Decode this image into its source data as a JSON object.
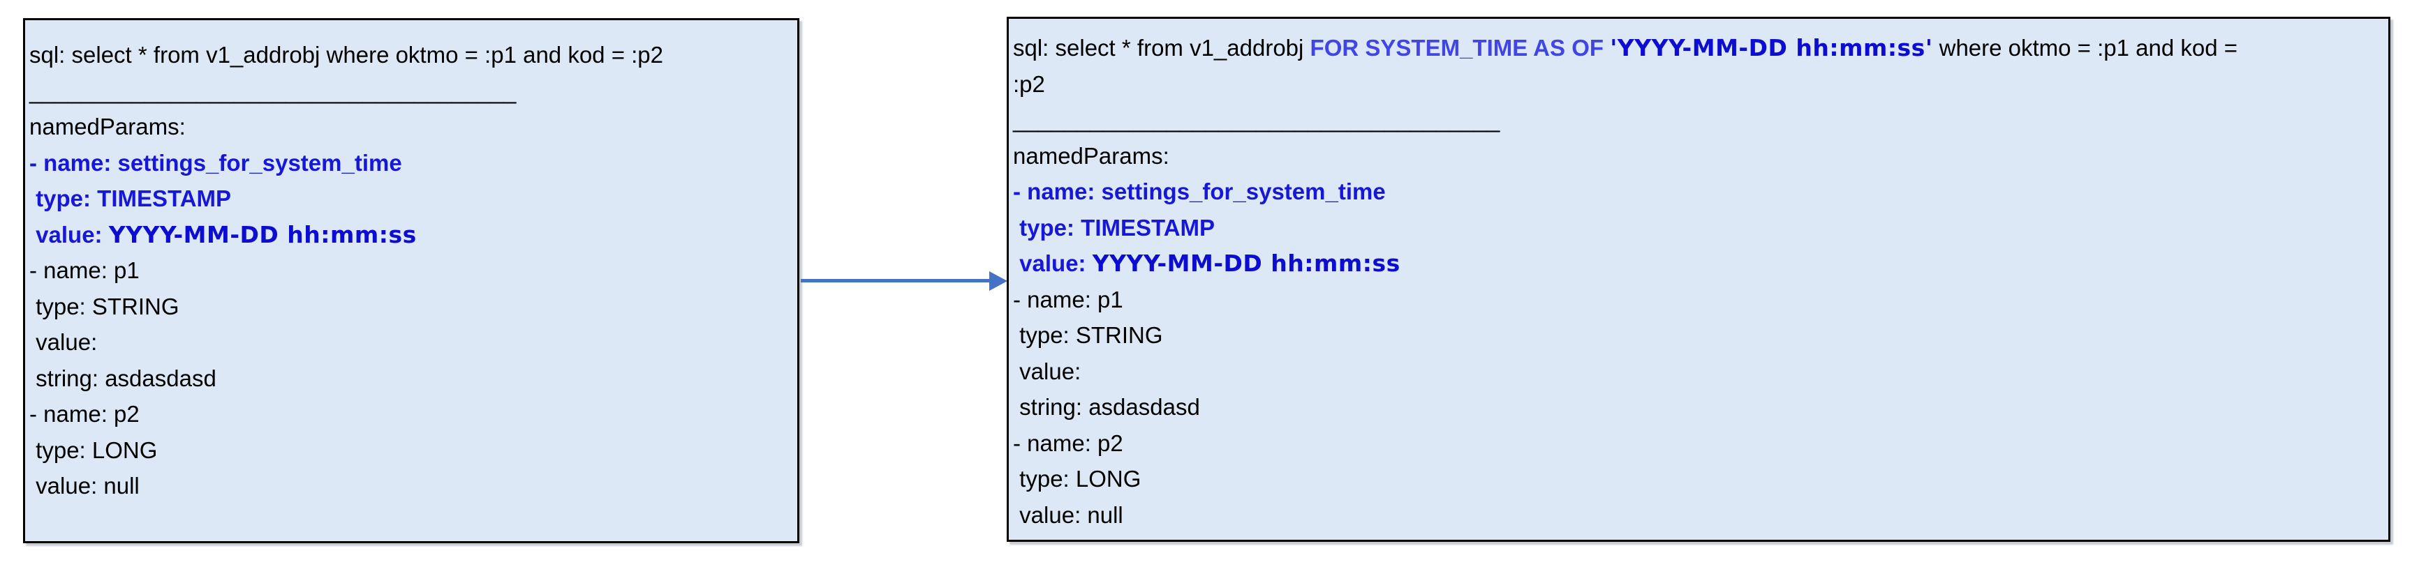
{
  "colors": {
    "box_fill": "#dce8f5",
    "box_border": "#000000",
    "text": "#000000",
    "keyword_blue": "#4045e4",
    "param_blue": "#1717d8",
    "timestamp_blue": "#0d0dd2",
    "arrow_blue": "#4472c4"
  },
  "left_box": {
    "lines": [
      {
        "name": "sql-line",
        "segments": [
          {
            "t": "sql: select * from v1_addrobj where oktmo = :p1 and kod = :p2",
            "s": "plain"
          }
        ]
      },
      {
        "name": "separator-line",
        "segments": [
          {
            "t": "______________________________________",
            "s": "plain"
          }
        ]
      },
      {
        "name": "named-params-label",
        "segments": [
          {
            "t": "namedParams:",
            "s": "plain"
          }
        ]
      },
      {
        "name": "param-settings-name",
        "segments": [
          {
            "t": "- name: settings_for_system_time",
            "s": "param"
          }
        ]
      },
      {
        "name": "param-settings-type",
        "segments": [
          {
            "t": " type: TIMESTAMP",
            "s": "param"
          }
        ]
      },
      {
        "name": "param-settings-value",
        "segments": [
          {
            "t": " value: ",
            "s": "param"
          },
          {
            "t": "YYYY-MM-DD hh:mm:ss",
            "s": "emph"
          }
        ]
      },
      {
        "name": "param-p1-name",
        "segments": [
          {
            "t": "- name: p1",
            "s": "plain"
          }
        ]
      },
      {
        "name": "param-p1-type",
        "segments": [
          {
            "t": " type: STRING",
            "s": "plain"
          }
        ]
      },
      {
        "name": "param-p1-value",
        "segments": [
          {
            "t": " value:",
            "s": "plain"
          }
        ]
      },
      {
        "name": "param-p1-string",
        "segments": [
          {
            "t": " string: asdasdasd",
            "s": "plain"
          }
        ]
      },
      {
        "name": "param-p2-name",
        "segments": [
          {
            "t": "- name: p2",
            "s": "plain"
          }
        ]
      },
      {
        "name": "param-p2-type",
        "segments": [
          {
            "t": " type: LONG",
            "s": "plain"
          }
        ]
      },
      {
        "name": "param-p2-value",
        "segments": [
          {
            "t": " value: null",
            "s": "plain"
          }
        ]
      }
    ]
  },
  "right_box": {
    "lines": [
      {
        "name": "sql-line-1",
        "segments": [
          {
            "t": "sql: select * from v1_addrobj ",
            "s": "plain"
          },
          {
            "t": "FOR SYSTEM_TIME AS OF ",
            "s": "keyword"
          },
          {
            "t": "'YYYY-MM-DD hh:mm:ss'",
            "s": "emph"
          },
          {
            "t": " where oktmo = :p1 and kod =",
            "s": "plain"
          }
        ]
      },
      {
        "name": "sql-line-2",
        "segments": [
          {
            "t": ":p2",
            "s": "plain"
          }
        ]
      },
      {
        "name": "separator-line",
        "segments": [
          {
            "t": "______________________________________",
            "s": "plain"
          }
        ]
      },
      {
        "name": "named-params-label",
        "segments": [
          {
            "t": "namedParams:",
            "s": "plain"
          }
        ]
      },
      {
        "name": "param-settings-name",
        "segments": [
          {
            "t": "- name: settings_for_system_time",
            "s": "param"
          }
        ]
      },
      {
        "name": "param-settings-type",
        "segments": [
          {
            "t": " type: TIMESTAMP",
            "s": "param"
          }
        ]
      },
      {
        "name": "param-settings-value",
        "segments": [
          {
            "t": " value: ",
            "s": "param"
          },
          {
            "t": "YYYY-MM-DD hh:mm:ss",
            "s": "emph"
          }
        ]
      },
      {
        "name": "param-p1-name",
        "segments": [
          {
            "t": "- name: p1",
            "s": "plain"
          }
        ]
      },
      {
        "name": "param-p1-type",
        "segments": [
          {
            "t": " type: STRING",
            "s": "plain"
          }
        ]
      },
      {
        "name": "param-p1-value",
        "segments": [
          {
            "t": " value:",
            "s": "plain"
          }
        ]
      },
      {
        "name": "param-p1-string",
        "segments": [
          {
            "t": " string: asdasdasd",
            "s": "plain"
          }
        ]
      },
      {
        "name": "param-p2-name",
        "segments": [
          {
            "t": "- name: p2",
            "s": "plain"
          }
        ]
      },
      {
        "name": "param-p2-type",
        "segments": [
          {
            "t": " type: LONG",
            "s": "plain"
          }
        ]
      },
      {
        "name": "param-p2-value",
        "segments": [
          {
            "t": " value: null",
            "s": "plain"
          }
        ]
      }
    ]
  }
}
